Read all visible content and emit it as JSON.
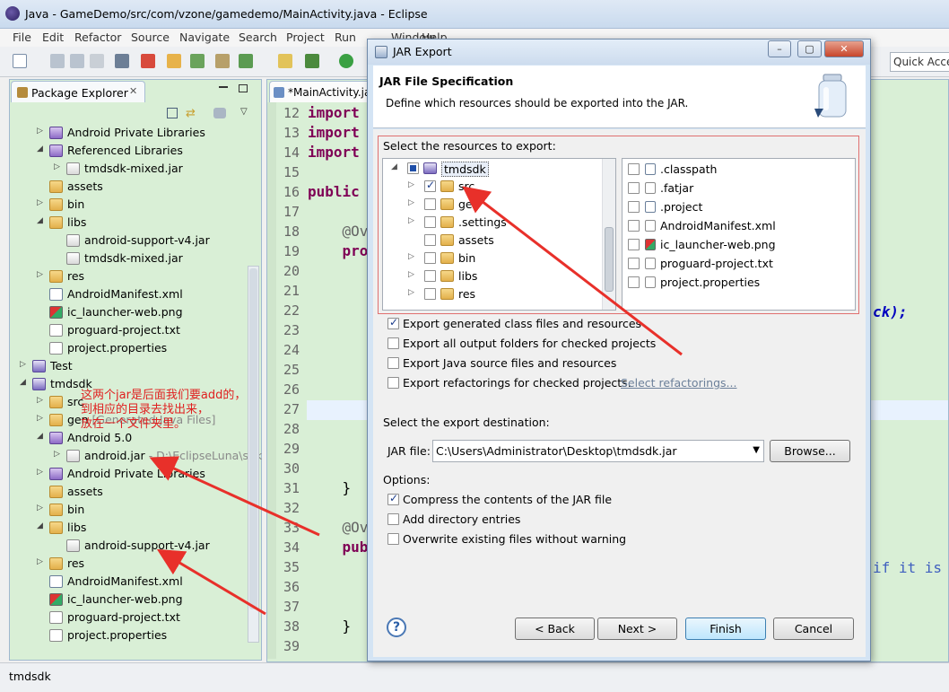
{
  "window": {
    "title": "Java - GameDemo/src/com/vzone/gamedemo/MainActivity.java - Eclipse"
  },
  "menu": [
    "File",
    "Edit",
    "Refactor",
    "Source",
    "Navigate",
    "Search",
    "Project",
    "Run",
    "Window",
    "Help"
  ],
  "toolbar": {
    "quick_access_placeholder": "Quick Access"
  },
  "package_explorer": {
    "tab_label": "Package Explorer",
    "rows": [
      {
        "indent": 1,
        "twisty": "▷",
        "icon": "lib",
        "label": "Android Private Libraries",
        "dec": ""
      },
      {
        "indent": 1,
        "twisty": "◢",
        "icon": "lib",
        "label": "Referenced Libraries",
        "dec": ""
      },
      {
        "indent": 2,
        "twisty": "▷",
        "icon": "jar",
        "label": "tmdsdk-mixed.jar",
        "dec": ""
      },
      {
        "indent": 1,
        "twisty": "",
        "icon": "folder",
        "label": "assets",
        "dec": ""
      },
      {
        "indent": 1,
        "twisty": "▷",
        "icon": "folder",
        "label": "bin",
        "dec": ""
      },
      {
        "indent": 1,
        "twisty": "◢",
        "icon": "folder",
        "label": "libs",
        "dec": ""
      },
      {
        "indent": 2,
        "twisty": "",
        "icon": "jar",
        "label": "android-support-v4.jar",
        "dec": ""
      },
      {
        "indent": 2,
        "twisty": "",
        "icon": "jar",
        "label": "tmdsdk-mixed.jar",
        "dec": ""
      },
      {
        "indent": 1,
        "twisty": "▷",
        "icon": "folder",
        "label": "res",
        "dec": ""
      },
      {
        "indent": 1,
        "twisty": "",
        "icon": "xml",
        "label": "AndroidManifest.xml",
        "dec": ""
      },
      {
        "indent": 1,
        "twisty": "",
        "icon": "png",
        "label": "ic_launcher-web.png",
        "dec": ""
      },
      {
        "indent": 1,
        "twisty": "",
        "icon": "file",
        "label": "proguard-project.txt",
        "dec": ""
      },
      {
        "indent": 1,
        "twisty": "",
        "icon": "file",
        "label": "project.properties",
        "dec": ""
      },
      {
        "indent": 0,
        "twisty": "▷",
        "icon": "proj",
        "label": "Test",
        "dec": ""
      },
      {
        "indent": 0,
        "twisty": "◢",
        "icon": "proj",
        "label": "tmdsdk",
        "dec": ""
      },
      {
        "indent": 1,
        "twisty": "▷",
        "icon": "src",
        "label": "src",
        "dec": ""
      },
      {
        "indent": 1,
        "twisty": "▷",
        "icon": "src",
        "label": "gen",
        "dec": " [Generated Java Files]"
      },
      {
        "indent": 1,
        "twisty": "◢",
        "icon": "lib",
        "label": "Android 5.0",
        "dec": ""
      },
      {
        "indent": 2,
        "twisty": "▷",
        "icon": "jar",
        "label": "android.jar",
        "dec": " - D:\\EclipseLuna\\sdk"
      },
      {
        "indent": 1,
        "twisty": "▷",
        "icon": "lib",
        "label": "Android Private Libraries",
        "dec": ""
      },
      {
        "indent": 1,
        "twisty": "",
        "icon": "folder",
        "label": "assets",
        "dec": ""
      },
      {
        "indent": 1,
        "twisty": "▷",
        "icon": "folder",
        "label": "bin",
        "dec": ""
      },
      {
        "indent": 1,
        "twisty": "◢",
        "icon": "folder",
        "label": "libs",
        "dec": ""
      },
      {
        "indent": 2,
        "twisty": "",
        "icon": "jar",
        "label": "android-support-v4.jar",
        "dec": ""
      },
      {
        "indent": 1,
        "twisty": "▷",
        "icon": "folder",
        "label": "res",
        "dec": ""
      },
      {
        "indent": 1,
        "twisty": "",
        "icon": "xml",
        "label": "AndroidManifest.xml",
        "dec": ""
      },
      {
        "indent": 1,
        "twisty": "",
        "icon": "png",
        "label": "ic_launcher-web.png",
        "dec": ""
      },
      {
        "indent": 1,
        "twisty": "",
        "icon": "file",
        "label": "proguard-project.txt",
        "dec": ""
      },
      {
        "indent": 1,
        "twisty": "",
        "icon": "file",
        "label": "project.properties",
        "dec": ""
      }
    ]
  },
  "annotation_text": [
    "这两个jar是后面我们要add的，",
    "到相应的目录去找出来，",
    "放在一个文件夹里。"
  ],
  "editor": {
    "tab_label": "*MainActivity.java",
    "lines": [
      {
        "n": "12",
        "parts": [
          [
            "kw",
            "import"
          ]
        ]
      },
      {
        "n": "13",
        "parts": [
          [
            "kw",
            "import"
          ]
        ]
      },
      {
        "n": "14",
        "parts": [
          [
            "kw",
            "import"
          ]
        ]
      },
      {
        "n": "15",
        "parts": []
      },
      {
        "n": "16",
        "parts": [
          [
            "kw",
            "public"
          ]
        ]
      },
      {
        "n": "17",
        "parts": []
      },
      {
        "n": "18",
        "parts": [
          [
            "",
            "    "
          ],
          [
            "ann",
            "@Ov"
          ]
        ]
      },
      {
        "n": "19",
        "parts": [
          [
            "",
            "    "
          ],
          [
            "kw",
            "pro"
          ]
        ]
      },
      {
        "n": "20",
        "parts": []
      },
      {
        "n": "21",
        "parts": []
      },
      {
        "n": "22",
        "parts": []
      },
      {
        "n": "23",
        "parts": []
      },
      {
        "n": "24",
        "parts": []
      },
      {
        "n": "25",
        "parts": []
      },
      {
        "n": "26",
        "parts": []
      },
      {
        "n": "27",
        "parts": []
      },
      {
        "n": "28",
        "parts": []
      },
      {
        "n": "29",
        "parts": []
      },
      {
        "n": "30",
        "parts": []
      },
      {
        "n": "31",
        "parts": [
          [
            "",
            "    }"
          ]
        ]
      },
      {
        "n": "32",
        "parts": []
      },
      {
        "n": "33",
        "parts": [
          [
            "",
            "    "
          ],
          [
            "ann",
            "@Ov"
          ]
        ]
      },
      {
        "n": "34",
        "parts": [
          [
            "",
            "    "
          ],
          [
            "kw",
            "pub"
          ]
        ]
      },
      {
        "n": "35",
        "parts": []
      },
      {
        "n": "36",
        "parts": []
      },
      {
        "n": "37",
        "parts": []
      },
      {
        "n": "38",
        "parts": [
          [
            "",
            "    }"
          ]
        ]
      },
      {
        "n": "39",
        "parts": []
      }
    ],
    "right_fragment_22": "ck);",
    "right_fragment_35": "if it is"
  },
  "status": {
    "text": "tmdsdk"
  },
  "dialog": {
    "title": "JAR Export",
    "heading": "JAR File Specification",
    "description": "Define which resources should be exported into the JAR.",
    "resources_label": "Select the resources to export:",
    "tree": [
      {
        "level": 0,
        "twisty": "◢",
        "check": "partial",
        "icon": "proj",
        "label": "tmdsdk"
      },
      {
        "level": 1,
        "twisty": "▷",
        "check": "on",
        "icon": "src",
        "label": "src"
      },
      {
        "level": 1,
        "twisty": "▷",
        "check": "off",
        "icon": "src",
        "label": "gen"
      },
      {
        "level": 1,
        "twisty": "▷",
        "check": "off",
        "icon": "folder",
        "label": ".settings"
      },
      {
        "level": 1,
        "twisty": "",
        "check": "off",
        "icon": "folder",
        "label": "assets"
      },
      {
        "level": 1,
        "twisty": "▷",
        "check": "off",
        "icon": "folder",
        "label": "bin"
      },
      {
        "level": 1,
        "twisty": "▷",
        "check": "off",
        "icon": "folder",
        "label": "libs"
      },
      {
        "level": 1,
        "twisty": "▷",
        "check": "off",
        "icon": "folder",
        "label": "res"
      }
    ],
    "files": [
      {
        "check": "off",
        "icon": "xml",
        "label": ".classpath"
      },
      {
        "check": "off",
        "icon": "file",
        "label": ".fatjar"
      },
      {
        "check": "off",
        "icon": "xml",
        "label": ".project"
      },
      {
        "check": "off",
        "icon": "file",
        "label": "AndroidManifest.xml"
      },
      {
        "check": "off",
        "icon": "png",
        "label": "ic_launcher-web.png"
      },
      {
        "check": "off",
        "icon": "file",
        "label": "proguard-project.txt"
      },
      {
        "check": "off",
        "icon": "file",
        "label": "project.properties"
      }
    ],
    "export_options": [
      {
        "checked": true,
        "label": "Export generated class files and resources"
      },
      {
        "checked": false,
        "label": "Export all output folders for checked projects"
      },
      {
        "checked": false,
        "label": "Export Java source files and resources"
      },
      {
        "checked": false,
        "label": "Export refactorings for checked projects."
      }
    ],
    "select_refactorings_link": "Select refactorings...",
    "destination_label": "Select the export destination:",
    "jar_file_label": "JAR file:",
    "jar_file_value": "C:\\Users\\Administrator\\Desktop\\tmdsdk.jar",
    "browse_button": "Browse...",
    "options_label": "Options:",
    "options": [
      {
        "checked": true,
        "label": "Compress the contents of the JAR file"
      },
      {
        "checked": false,
        "label": "Add directory entries"
      },
      {
        "checked": false,
        "label": "Overwrite existing files without warning"
      }
    ],
    "buttons": {
      "back": "< Back",
      "next": "Next >",
      "finish": "Finish",
      "cancel": "Cancel"
    },
    "help_symbol": "?"
  },
  "colors": {
    "annotation": "#e02020",
    "package_bg": "#d9efd6",
    "dialog_bg": "#f0f0f0"
  }
}
